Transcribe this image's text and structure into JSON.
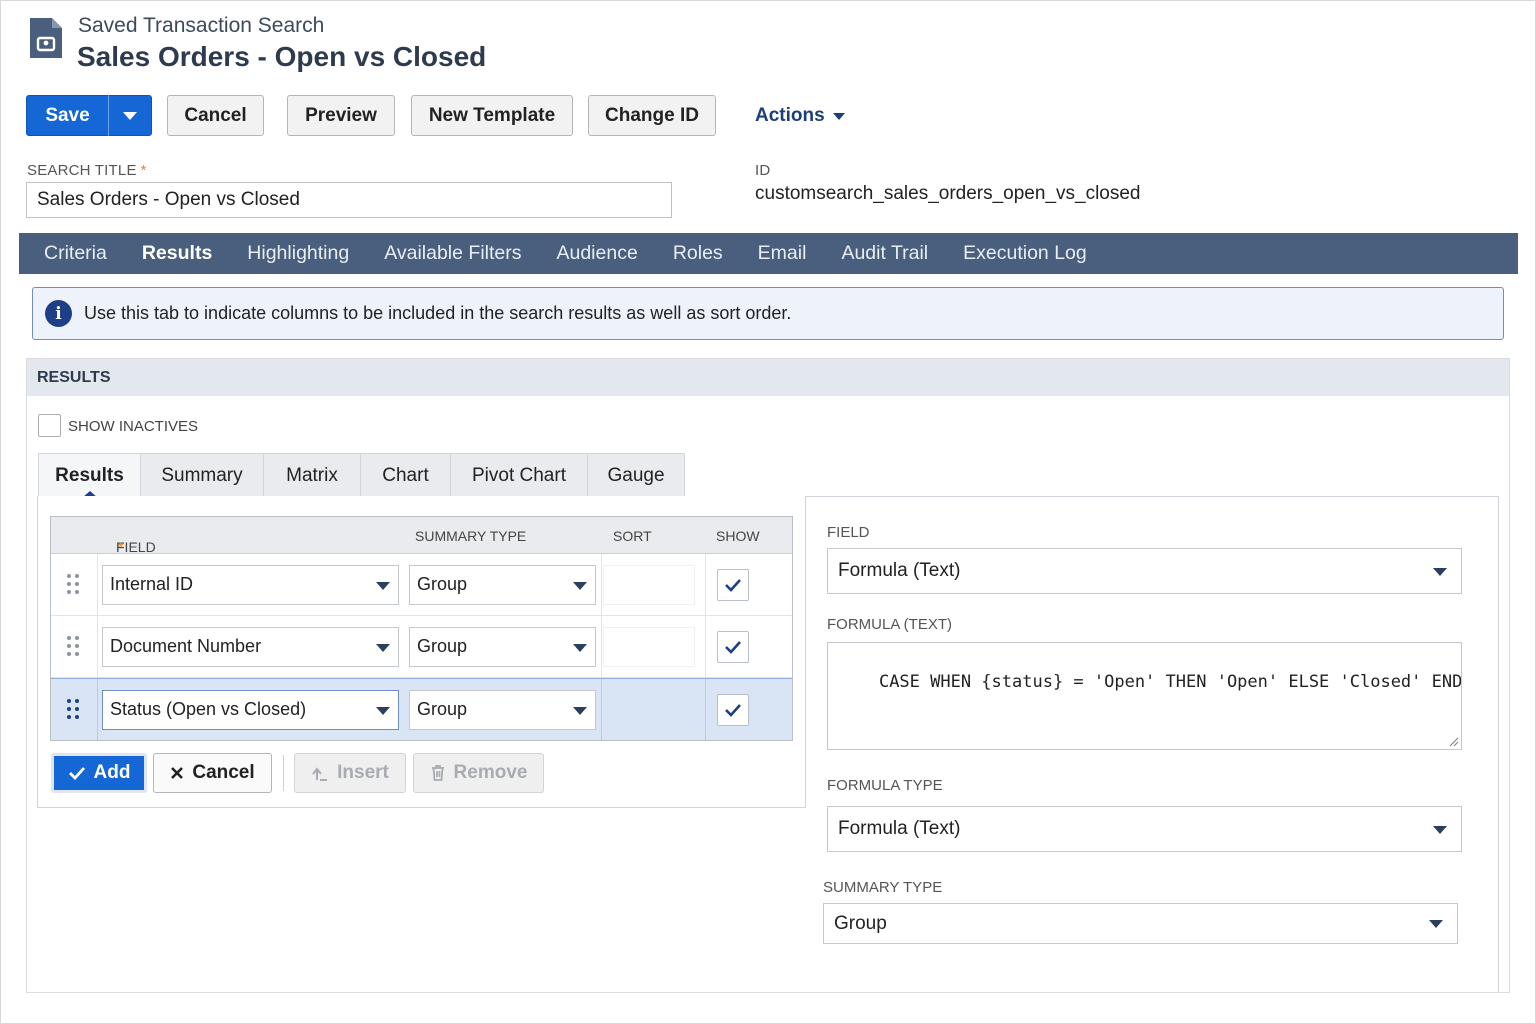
{
  "header": {
    "subtitle": "Saved Transaction Search",
    "title": "Sales Orders - Open vs Closed"
  },
  "toolbar": {
    "save_label": "Save",
    "cancel_label": "Cancel",
    "preview_label": "Preview",
    "new_template_label": "New Template",
    "change_id_label": "Change ID",
    "actions_label": "Actions"
  },
  "fields": {
    "search_title_label": "SEARCH TITLE",
    "required_mark": "*",
    "search_title_value": "Sales Orders - Open vs Closed",
    "id_label": "ID",
    "id_value": "customsearch_sales_orders_open_vs_closed"
  },
  "main_tabs": [
    "Criteria",
    "Results",
    "Highlighting",
    "Available Filters",
    "Audience",
    "Roles",
    "Email",
    "Audit Trail",
    "Execution Log"
  ],
  "main_tabs_active": "Results",
  "info_banner": {
    "icon": "info-icon",
    "text": "Use this tab to indicate columns to be included in the search results as well as sort order."
  },
  "results": {
    "section_title": "RESULTS",
    "show_inactives_label": "SHOW INACTIVES",
    "sub_tabs": [
      "Results",
      "Summary",
      "Matrix",
      "Chart",
      "Pivot Chart",
      "Gauge"
    ],
    "sub_tabs_active": "Results",
    "columns": {
      "field": "FIELD",
      "summary_type": "SUMMARY TYPE",
      "sort": "SORT",
      "show": "SHOW"
    },
    "rows": [
      {
        "field": "Internal ID",
        "summary_type": "Group",
        "sort": "",
        "show": true
      },
      {
        "field": "Document Number",
        "summary_type": "Group",
        "sort": "",
        "show": true
      },
      {
        "field": "Status (Open vs Closed)",
        "summary_type": "Group",
        "sort": "",
        "show": true,
        "selected": true
      }
    ],
    "buttons": {
      "add": "Add",
      "cancel": "Cancel",
      "insert": "Insert",
      "remove": "Remove"
    }
  },
  "detail": {
    "field_label": "FIELD",
    "field_value": "Formula (Text)",
    "formula_label": "FORMULA (TEXT)",
    "formula_value": "CASE WHEN {status} = 'Open' THEN 'Open' ELSE 'Closed' END",
    "formula_type_label": "FORMULA TYPE",
    "formula_type_value": "Formula (Text)",
    "summary_type_label": "SUMMARY TYPE",
    "summary_type_value": "Group"
  },
  "colors": {
    "primary_button": "#1467d4",
    "tab_bar": "#4a5e7d",
    "info_border": "#6f8fc4",
    "link": "#1c3f7a",
    "required": "#e08a1e"
  }
}
